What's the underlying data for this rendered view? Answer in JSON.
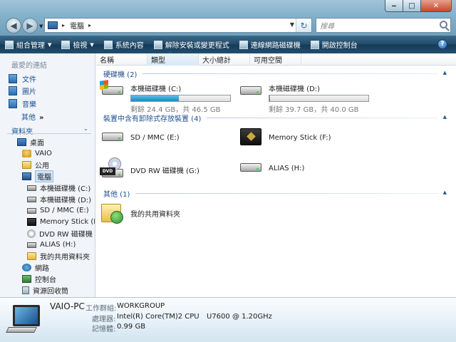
{
  "titlebar": {
    "minimize": "‒",
    "maximize": "□",
    "close": "✕"
  },
  "address": {
    "path": "電腦",
    "chevron": "▸"
  },
  "search": {
    "placeholder": "搜尋"
  },
  "toolbar": {
    "organize": "組合管理",
    "views": "檢視",
    "system_properties": "系統內容",
    "uninstall": "解除安裝或變更程式",
    "map_drive": "連線網路磁碟機",
    "control_panel": "開啟控制台",
    "help": "?"
  },
  "favorites": {
    "header": "最愛的連結",
    "items": [
      "文件",
      "圖片",
      "音樂"
    ],
    "other": "其他",
    "other_arrow": "»"
  },
  "folders": {
    "header": "資料夾",
    "collapse": "⌄",
    "tree": [
      {
        "label": "桌面"
      },
      {
        "label": "VAIO"
      },
      {
        "label": "公用"
      },
      {
        "label": "電腦"
      },
      {
        "label": "本機磁碟機 (C:)"
      },
      {
        "label": "本機磁碟機 (D:)"
      },
      {
        "label": "SD / MMC (E:)"
      },
      {
        "label": "Memory Stick (F:)"
      },
      {
        "label": "DVD RW 磁碟機 (G:)"
      },
      {
        "label": "ALIAS (H:)"
      },
      {
        "label": "我的共用資料夾"
      },
      {
        "label": "網路"
      },
      {
        "label": "控制台"
      },
      {
        "label": "資源回收筒"
      }
    ]
  },
  "columns": {
    "name": "名稱",
    "type": "類型",
    "total_size": "大小總計",
    "free_space": "可用空間",
    "sort_arrow": "^"
  },
  "groups": {
    "hard_drives": "硬碟機 (2)",
    "removable": "裝置中含有卸除式存放裝置 (4)",
    "other": "其他 (1)",
    "collapse": "▲"
  },
  "drives": {
    "c": {
      "label": "本機磁碟機 (C:)",
      "info": "剩餘 24.4 GB，共 46.5 GB",
      "used_fraction": 0.48
    },
    "d": {
      "label": "本機磁碟機 (D:)",
      "info": "剩餘 39.7 GB，共 40.0 GB",
      "used_fraction": 0.01
    }
  },
  "devices": {
    "e": {
      "label": "SD / MMC (E:)"
    },
    "f": {
      "label": "Memory Stick (F:)"
    },
    "g": {
      "label": "DVD RW 磁碟機 (G:)",
      "badge": "DVD"
    },
    "h": {
      "label": "ALIAS (H:)"
    }
  },
  "other_items": {
    "shared": "我的共用資料夾"
  },
  "details": {
    "name": "VAIO-PC",
    "workgroup_label": "工作群組:",
    "workgroup_value": "WORKGROUP",
    "processor_label": "處理器:",
    "processor_value": "Intel(R) Core(TM)2 CPU",
    "processor_model": "U7600  @ 1.20GHz",
    "memory_label": "記憶體:",
    "memory_value": "0.99 GB"
  }
}
